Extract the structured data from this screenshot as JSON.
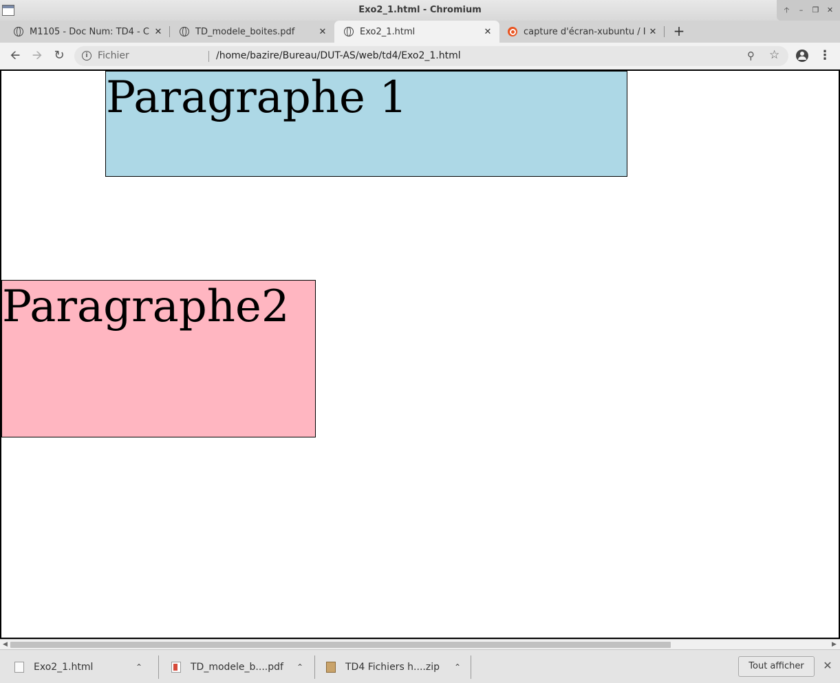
{
  "window": {
    "title": "Exo2_1.html - Chromium"
  },
  "tabs": [
    {
      "label": "M1105 - Doc Num: TD4 - C",
      "favicon": "globe-icon",
      "active": false
    },
    {
      "label": "TD_modele_boites.pdf",
      "favicon": "globe-icon",
      "active": false
    },
    {
      "label": "Exo2_1.html",
      "favicon": "globe-icon",
      "active": true
    },
    {
      "label": "capture d'écran-xubuntu / I",
      "favicon": "ubuntu-icon",
      "active": false
    }
  ],
  "toolbar": {
    "scheme_label": "Fichier",
    "url": "/home/bazire/Bureau/DUT-AS/web/td4/Exo2_1.html"
  },
  "page": {
    "paragraph1": {
      "text": "Paragraphe 1",
      "color": "#add8e6"
    },
    "paragraph2": {
      "text": "Paragraphe2",
      "color": "#ffb6c1"
    }
  },
  "downloads": {
    "items": [
      {
        "label": "Exo2_1.html",
        "icon": "html-file-icon"
      },
      {
        "label": "TD_modele_b....pdf",
        "icon": "pdf-file-icon"
      },
      {
        "label": "TD4 Fichiers h....zip",
        "icon": "zip-file-icon"
      }
    ],
    "show_all_label": "Tout afficher"
  }
}
